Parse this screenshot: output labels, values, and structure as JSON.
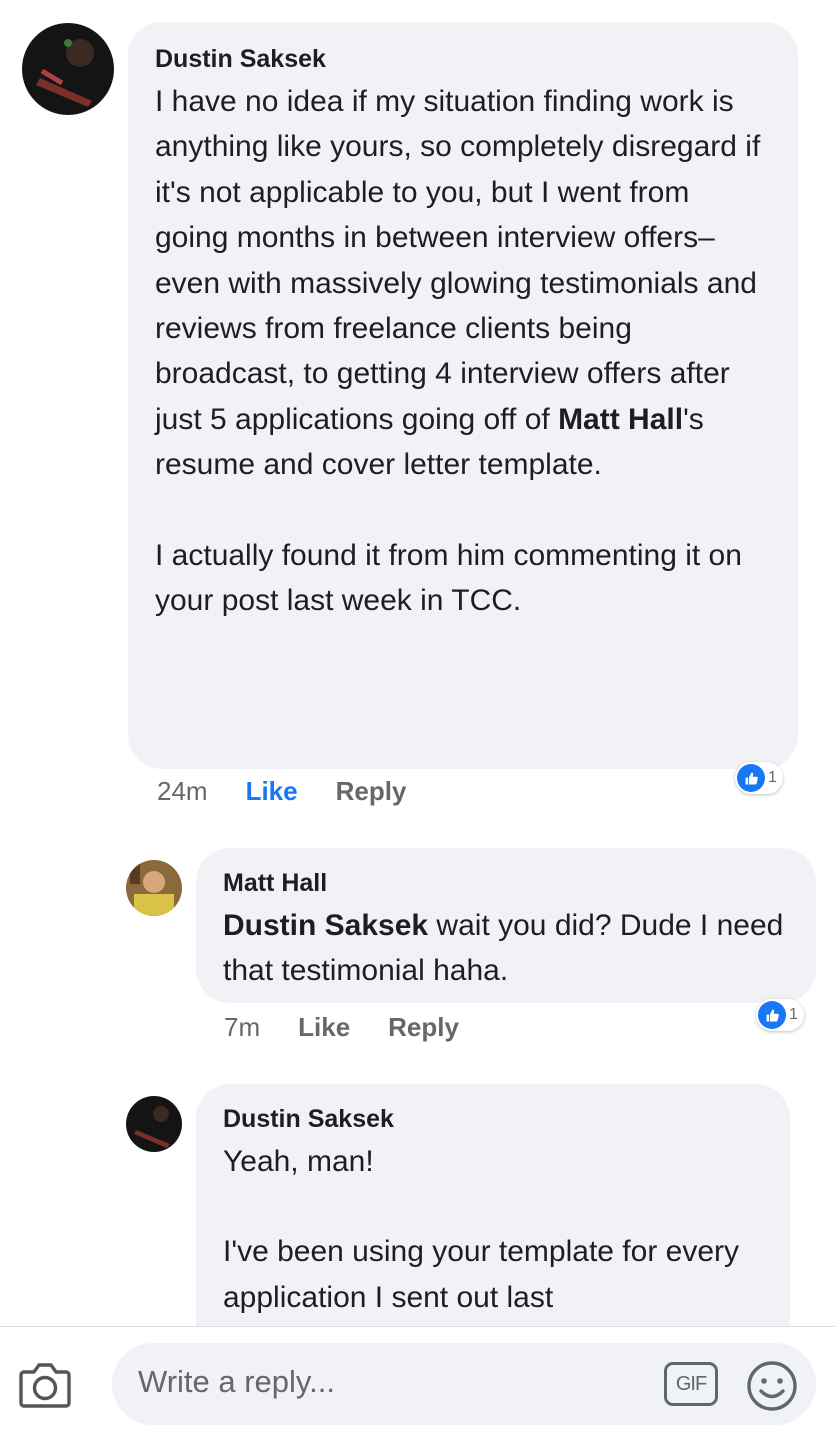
{
  "comments": [
    {
      "author": "Dustin Saksek",
      "paragraphs": [
        {
          "before": "I have no idea if my situation finding work is anything like yours, so completely disregard if it's not applicable to you, but I went from going months in between interview offers–even with massively glowing testimonials and reviews from freelance clients being broadcast, to getting 4 interview offers after just 5 applications going off of ",
          "mention": "Matt Hall",
          "after": "'s resume and cover letter template."
        },
        {
          "text": "I actually found it from him commenting it on your post last week in TCC."
        }
      ],
      "time": "24m",
      "like_label": "Like",
      "reply_label": "Reply",
      "reaction_count": "1",
      "like_color": "#1877f2"
    },
    {
      "author": "Matt Hall",
      "mention": "Dustin Saksek",
      "text": " wait you did? Dude I need that testimonial haha.",
      "time": "7m",
      "like_label": "Like",
      "reply_label": "Reply",
      "reaction_count": "1"
    },
    {
      "author": "Dustin Saksek",
      "paragraphs": [
        {
          "text": "Yeah, man!"
        },
        {
          "text": "I've been using your template for every application I sent out last"
        }
      ]
    }
  ],
  "composer": {
    "placeholder": "Write a reply...",
    "camera_icon": "camera-icon",
    "gif_label": "GIF",
    "emoji_icon": "emoji-icon"
  }
}
